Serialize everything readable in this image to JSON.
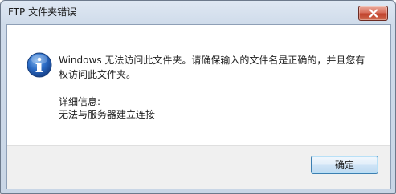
{
  "window": {
    "title": "FTP 文件夹错误"
  },
  "controls": {
    "close_icon": "close-icon"
  },
  "dialog": {
    "icon": "info-icon",
    "message": "Windows 无法访问此文件夹。请确保输入的文件名是正确的，并且您有权访问此文件夹。",
    "details_label": "详细信息:",
    "details_text": "无法与服务器建立连接"
  },
  "buttons": {
    "ok_label": "确定"
  },
  "colors": {
    "close_button_red": "#c0412b",
    "info_icon_blue": "#2a6bc5",
    "ok_button_border": "#3c7fb1"
  }
}
